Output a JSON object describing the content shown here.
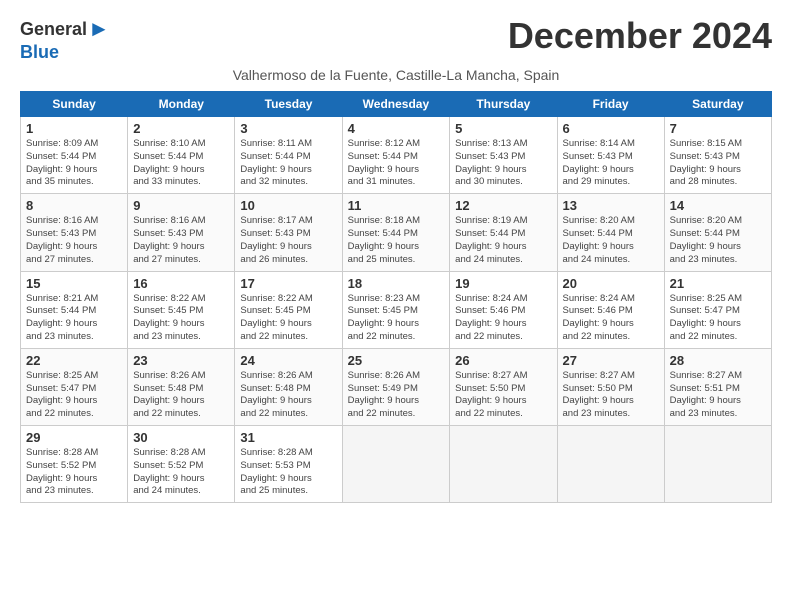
{
  "logo": {
    "general": "General",
    "blue": "Blue",
    "arrow": "▶"
  },
  "title": "December 2024",
  "subtitle": "Valhermoso de la Fuente, Castille-La Mancha, Spain",
  "days": [
    "Sunday",
    "Monday",
    "Tuesday",
    "Wednesday",
    "Thursday",
    "Friday",
    "Saturday"
  ],
  "weeks": [
    [
      {
        "day": "1",
        "info": "Sunrise: 8:09 AM\nSunset: 5:44 PM\nDaylight: 9 hours\nand 35 minutes."
      },
      {
        "day": "2",
        "info": "Sunrise: 8:10 AM\nSunset: 5:44 PM\nDaylight: 9 hours\nand 33 minutes."
      },
      {
        "day": "3",
        "info": "Sunrise: 8:11 AM\nSunset: 5:44 PM\nDaylight: 9 hours\nand 32 minutes."
      },
      {
        "day": "4",
        "info": "Sunrise: 8:12 AM\nSunset: 5:44 PM\nDaylight: 9 hours\nand 31 minutes."
      },
      {
        "day": "5",
        "info": "Sunrise: 8:13 AM\nSunset: 5:43 PM\nDaylight: 9 hours\nand 30 minutes."
      },
      {
        "day": "6",
        "info": "Sunrise: 8:14 AM\nSunset: 5:43 PM\nDaylight: 9 hours\nand 29 minutes."
      },
      {
        "day": "7",
        "info": "Sunrise: 8:15 AM\nSunset: 5:43 PM\nDaylight: 9 hours\nand 28 minutes."
      }
    ],
    [
      {
        "day": "8",
        "info": "Sunrise: 8:16 AM\nSunset: 5:43 PM\nDaylight: 9 hours\nand 27 minutes."
      },
      {
        "day": "9",
        "info": "Sunrise: 8:16 AM\nSunset: 5:43 PM\nDaylight: 9 hours\nand 27 minutes."
      },
      {
        "day": "10",
        "info": "Sunrise: 8:17 AM\nSunset: 5:43 PM\nDaylight: 9 hours\nand 26 minutes."
      },
      {
        "day": "11",
        "info": "Sunrise: 8:18 AM\nSunset: 5:44 PM\nDaylight: 9 hours\nand 25 minutes."
      },
      {
        "day": "12",
        "info": "Sunrise: 8:19 AM\nSunset: 5:44 PM\nDaylight: 9 hours\nand 24 minutes."
      },
      {
        "day": "13",
        "info": "Sunrise: 8:20 AM\nSunset: 5:44 PM\nDaylight: 9 hours\nand 24 minutes."
      },
      {
        "day": "14",
        "info": "Sunrise: 8:20 AM\nSunset: 5:44 PM\nDaylight: 9 hours\nand 23 minutes."
      }
    ],
    [
      {
        "day": "15",
        "info": "Sunrise: 8:21 AM\nSunset: 5:44 PM\nDaylight: 9 hours\nand 23 minutes."
      },
      {
        "day": "16",
        "info": "Sunrise: 8:22 AM\nSunset: 5:45 PM\nDaylight: 9 hours\nand 23 minutes."
      },
      {
        "day": "17",
        "info": "Sunrise: 8:22 AM\nSunset: 5:45 PM\nDaylight: 9 hours\nand 22 minutes."
      },
      {
        "day": "18",
        "info": "Sunrise: 8:23 AM\nSunset: 5:45 PM\nDaylight: 9 hours\nand 22 minutes."
      },
      {
        "day": "19",
        "info": "Sunrise: 8:24 AM\nSunset: 5:46 PM\nDaylight: 9 hours\nand 22 minutes."
      },
      {
        "day": "20",
        "info": "Sunrise: 8:24 AM\nSunset: 5:46 PM\nDaylight: 9 hours\nand 22 minutes."
      },
      {
        "day": "21",
        "info": "Sunrise: 8:25 AM\nSunset: 5:47 PM\nDaylight: 9 hours\nand 22 minutes."
      }
    ],
    [
      {
        "day": "22",
        "info": "Sunrise: 8:25 AM\nSunset: 5:47 PM\nDaylight: 9 hours\nand 22 minutes."
      },
      {
        "day": "23",
        "info": "Sunrise: 8:26 AM\nSunset: 5:48 PM\nDaylight: 9 hours\nand 22 minutes."
      },
      {
        "day": "24",
        "info": "Sunrise: 8:26 AM\nSunset: 5:48 PM\nDaylight: 9 hours\nand 22 minutes."
      },
      {
        "day": "25",
        "info": "Sunrise: 8:26 AM\nSunset: 5:49 PM\nDaylight: 9 hours\nand 22 minutes."
      },
      {
        "day": "26",
        "info": "Sunrise: 8:27 AM\nSunset: 5:50 PM\nDaylight: 9 hours\nand 22 minutes."
      },
      {
        "day": "27",
        "info": "Sunrise: 8:27 AM\nSunset: 5:50 PM\nDaylight: 9 hours\nand 23 minutes."
      },
      {
        "day": "28",
        "info": "Sunrise: 8:27 AM\nSunset: 5:51 PM\nDaylight: 9 hours\nand 23 minutes."
      }
    ],
    [
      {
        "day": "29",
        "info": "Sunrise: 8:28 AM\nSunset: 5:52 PM\nDaylight: 9 hours\nand 23 minutes."
      },
      {
        "day": "30",
        "info": "Sunrise: 8:28 AM\nSunset: 5:52 PM\nDaylight: 9 hours\nand 24 minutes."
      },
      {
        "day": "31",
        "info": "Sunrise: 8:28 AM\nSunset: 5:53 PM\nDaylight: 9 hours\nand 25 minutes."
      },
      null,
      null,
      null,
      null
    ]
  ]
}
